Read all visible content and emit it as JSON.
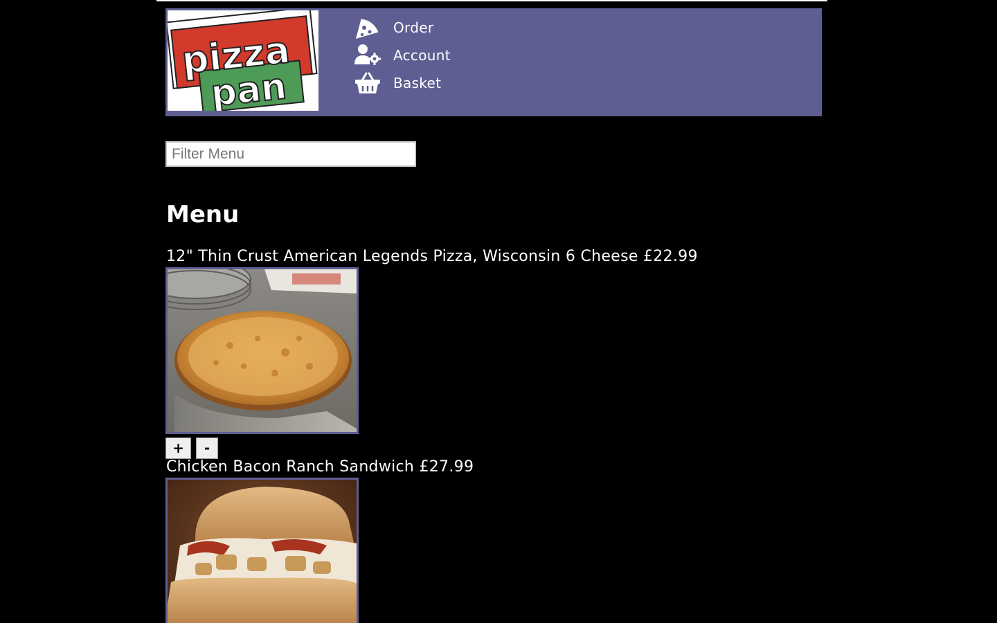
{
  "brand": {
    "logo_word_1": "pizza",
    "logo_word_2": "pan",
    "colors": {
      "header_bg": "#5e5e93",
      "logo_red": "#d23a2c",
      "logo_green": "#4e9a57",
      "page_bg": "#000000"
    }
  },
  "nav": {
    "items": [
      {
        "label": "Order",
        "icon": "pizza-slice-icon"
      },
      {
        "label": "Account",
        "icon": "user-gear-icon"
      },
      {
        "label": "Basket",
        "icon": "basket-icon"
      }
    ]
  },
  "filter": {
    "placeholder": "Filter Menu",
    "value": ""
  },
  "menu": {
    "heading": "Menu",
    "items": [
      {
        "title": "12\" Thin Crust American Legends Pizza, Wisconsin 6 Cheese £22.99",
        "image": "pizza-photo",
        "add_label": "+",
        "remove_label": "-"
      },
      {
        "title": "Chicken Bacon Ranch Sandwich £27.99",
        "image": "sandwich-photo"
      }
    ]
  }
}
